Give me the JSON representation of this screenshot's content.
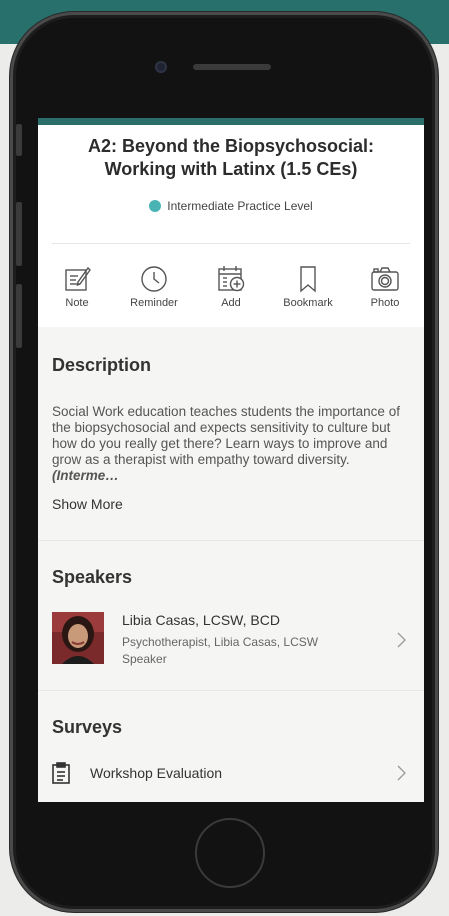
{
  "session": {
    "title": "A2: Beyond the Biopsychosocial: Working with Latinx (1.5 CEs)",
    "level": "Intermediate Practice Level",
    "level_color": "#4ab4b4"
  },
  "actions": [
    {
      "label": "Note",
      "icon": "note-icon"
    },
    {
      "label": "Reminder",
      "icon": "clock-icon"
    },
    {
      "label": "Add",
      "icon": "calendar-add-icon"
    },
    {
      "label": "Bookmark",
      "icon": "bookmark-icon"
    },
    {
      "label": "Photo",
      "icon": "camera-icon"
    }
  ],
  "description": {
    "heading": "Description",
    "text": "Social Work education teaches students the importance of the biopsychosocial and expects sensitivity to culture but how do you really get there? Learn ways to improve and grow as a therapist with empathy toward diversity.",
    "emphasis": "(Interme…",
    "show_more": "Show More"
  },
  "speakers": {
    "heading": "Speakers",
    "items": [
      {
        "name": "Libia Casas,  LCSW, BCD",
        "subtitle": "Psychotherapist, Libia Casas, LCSW",
        "role": "Speaker"
      }
    ]
  },
  "surveys": {
    "heading": "Surveys",
    "items": [
      {
        "label": "Workshop Evaluation",
        "icon": "clipboard-icon"
      }
    ]
  },
  "theme": {
    "accent": "#27706c"
  }
}
